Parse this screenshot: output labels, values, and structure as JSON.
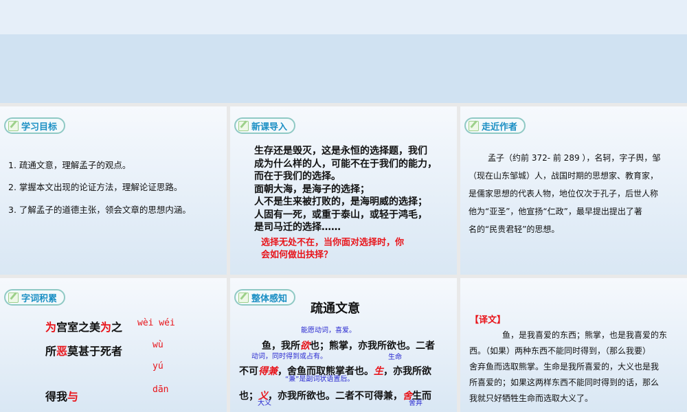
{
  "slides": [
    {
      "tag": "学习目标",
      "items": [
        "1. 疏通文意，理解孟子的观点。",
        "2. 掌握本文出现的论证方法，理解论证思路。",
        "3. 了解孟子的道德主张，领会文章的思想内涵。"
      ]
    },
    {
      "tag": "新课导入",
      "lines": [
        "生存还是毁灭，这是永恒的选择题，我们",
        "成为什么样的人，可能不在于我们的能力，",
        "而在于我们的选择。",
        "面朝大海，是海子的选择；",
        "人不是生来被打败的，是海明威的选择；",
        "人固有一死，或重于泰山，或轻于鸿毛，",
        "是司马迁的选择……"
      ],
      "question": [
        "选择无处不在，当你面对选择时，你",
        "会如何做出抉择？"
      ]
    },
    {
      "tag": "走近作者",
      "lines": [
        "孟子（约前 372- 前 289 ），名轲，字子舆，邹",
        "（现在山东邹城）人，战国时期的思想家、教育家，",
        "是儒家思想的代表人物，地位仅次于孔子，后世人称",
        "他为“亚圣”，他宣扬“仁政”，最早提出提出了著",
        "名的“民贵君轻”的思想。"
      ]
    },
    {
      "tag": "字词积累",
      "row1": {
        "a": "为",
        "b": "宫室之美",
        "c": "为",
        "d": "之"
      },
      "row2": {
        "a": "所",
        "b": "恶",
        "c": "莫甚于死者"
      },
      "row3": {
        "a": "得我",
        "b": "与"
      },
      "pinyin": [
        "wèi wéi",
        "wù",
        "yú",
        "dān"
      ]
    },
    {
      "tag": "整体感知",
      "title": "疏通文意",
      "notes": [
        "能愿动词，喜爱。",
        "动词，同时得到或占有。",
        "生命",
        "“兼”是副词状语置后。",
        "大义",
        "舍弃"
      ],
      "l1": [
        "鱼，我所",
        "欲",
        "也；熊掌，亦我所欲也。二者"
      ],
      "l2": [
        "不可",
        "得兼",
        "，舍鱼而取熊掌者也。",
        "生",
        "，亦我所欲"
      ],
      "l3": [
        "也；",
        "义",
        "，亦我所欲也。二者不可得兼，",
        "舍",
        "生而"
      ]
    },
    {
      "label": "【译文】",
      "lines": [
        "鱼，是我喜爱的东西；熊掌，也是我喜爱的东",
        "西。（如果）两种东西不能同时得到，（那么我要）",
        "舍弃鱼而选取熊掌。生命是我所喜爱的，大义也是我",
        "所喜爱的；如果这两样东西不能同时得到的话，那么",
        "我就只好牺牲生命而选取大义了。"
      ]
    }
  ]
}
